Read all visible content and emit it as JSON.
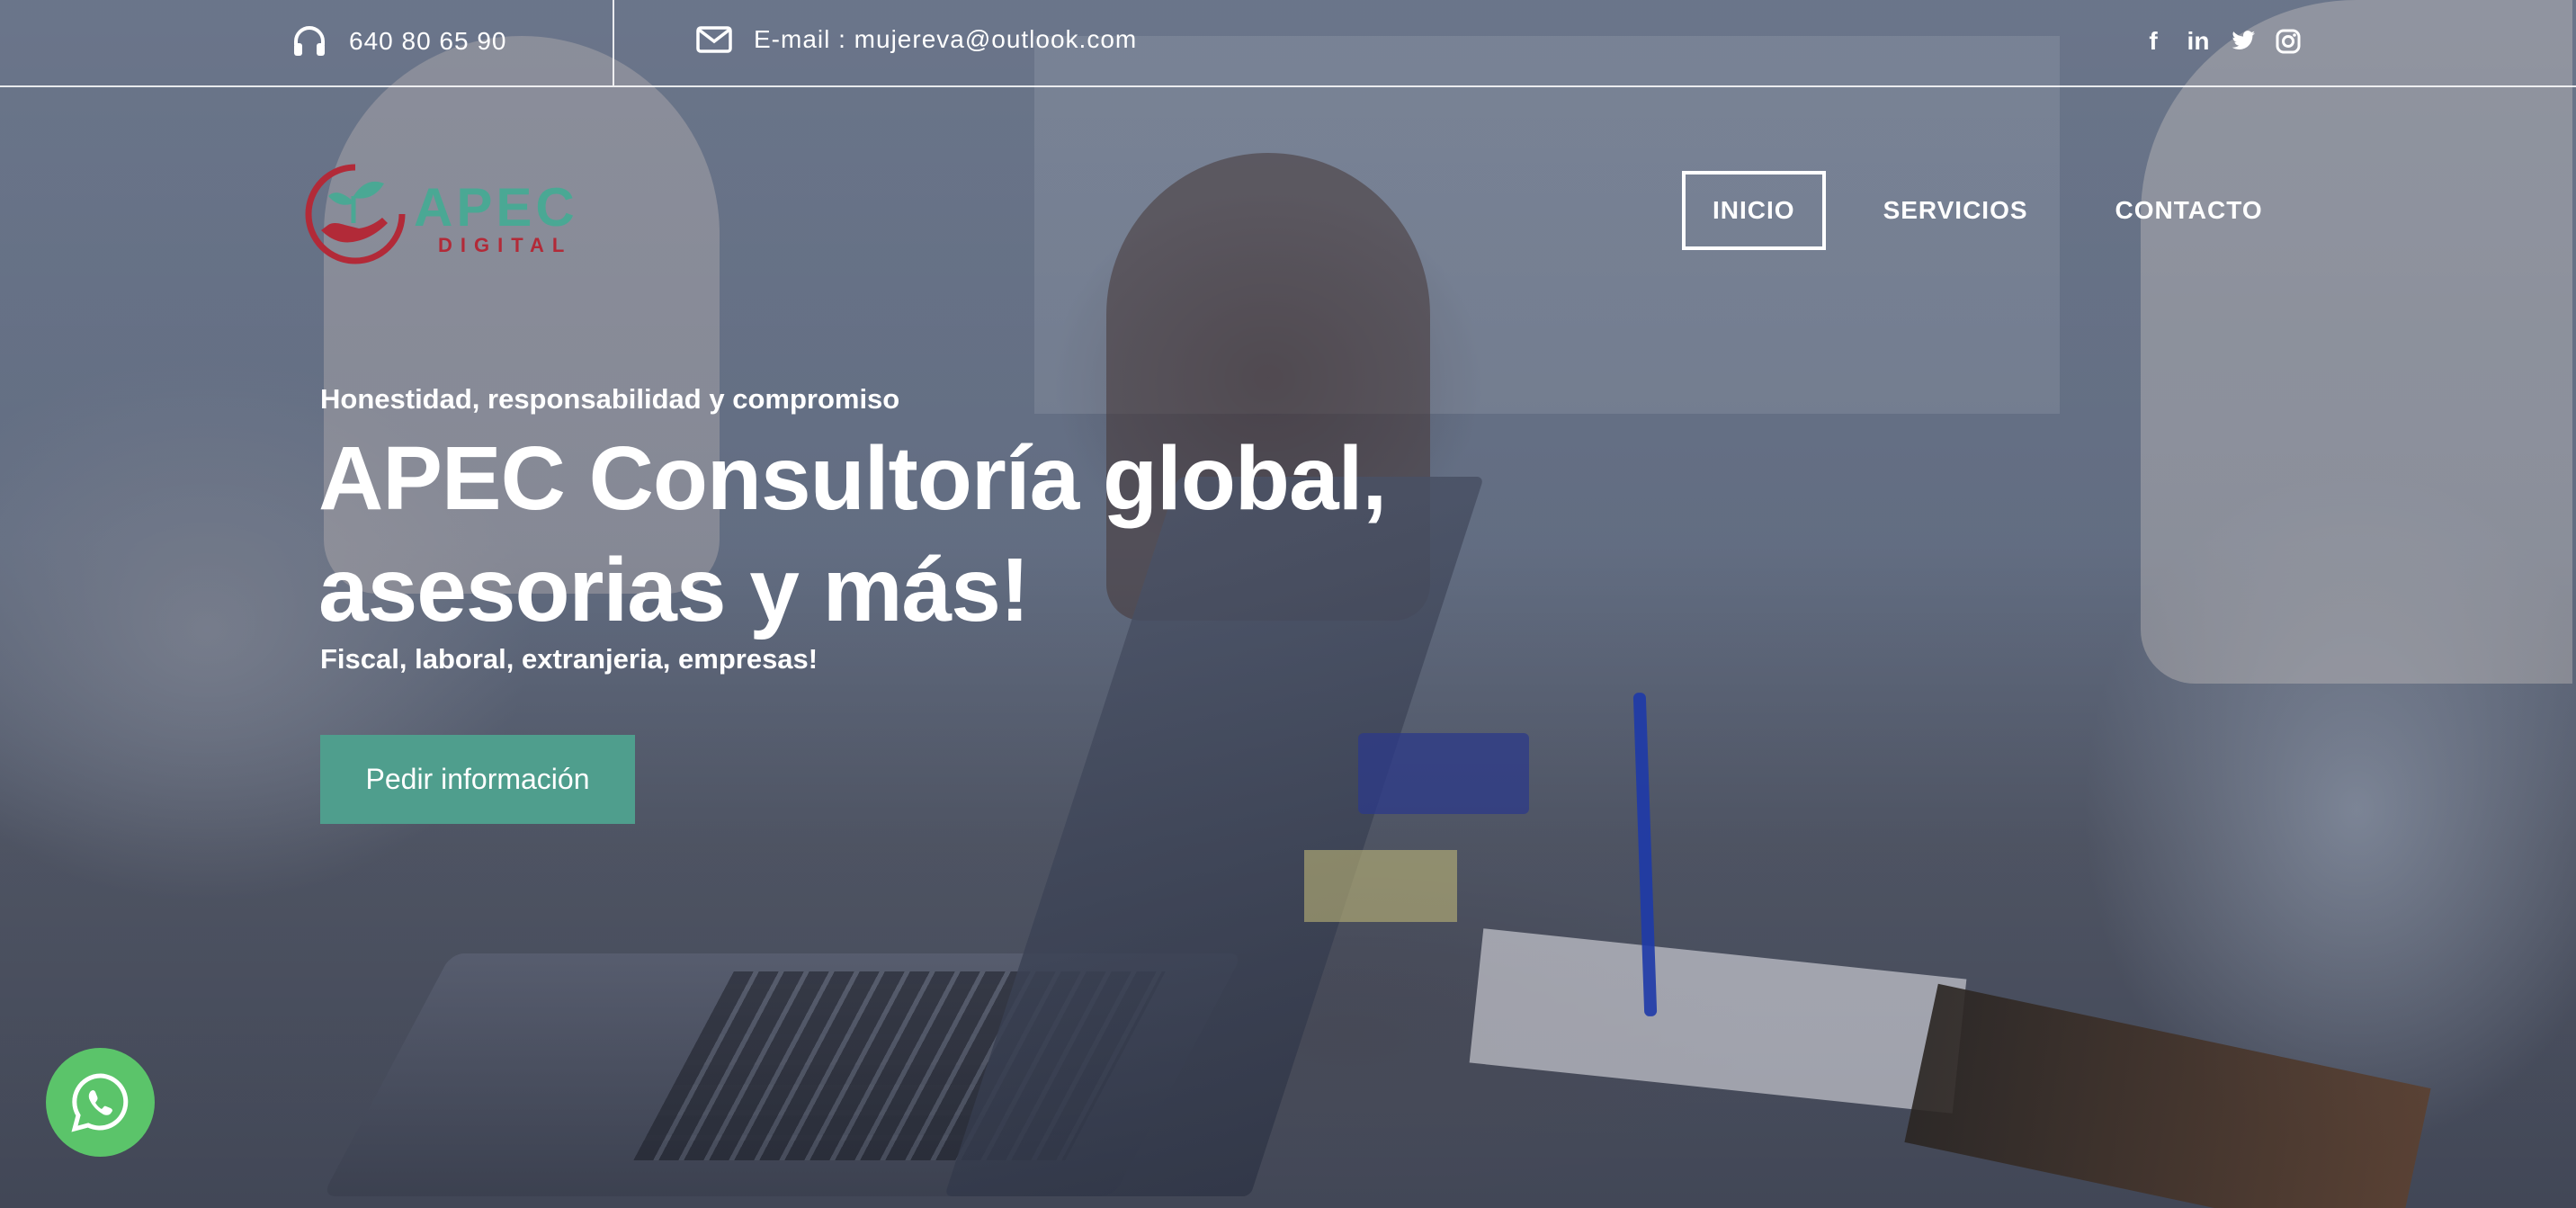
{
  "topbar": {
    "phone": "640 80 65 90",
    "email": "E-mail : mujereva@outlook.com",
    "social": [
      "f",
      "in"
    ]
  },
  "logo": {
    "name": "APEC",
    "sub": "DIGITAL"
  },
  "nav": {
    "items": [
      "INICIO",
      "SERVICIOS",
      "CONTACTO"
    ],
    "active": "INICIO"
  },
  "hero": {
    "kicker": "Honestidad, responsabilidad y compromiso",
    "title_line1": "APEC Consultoría global,",
    "title_line2": "asesorias y más!",
    "subtitle": "Fiscal, laboral, extranjeria, empresas!",
    "cta": "Pedir información"
  },
  "colors": {
    "accent": "#4f9e8d",
    "logo_green": "#4aa894",
    "logo_red": "#b22a38",
    "whatsapp": "#5bc46a"
  },
  "icons": [
    "headphones-icon",
    "mail-icon",
    "facebook-icon",
    "linkedin-icon",
    "twitter-icon",
    "instagram-icon",
    "whatsapp-icon"
  ]
}
